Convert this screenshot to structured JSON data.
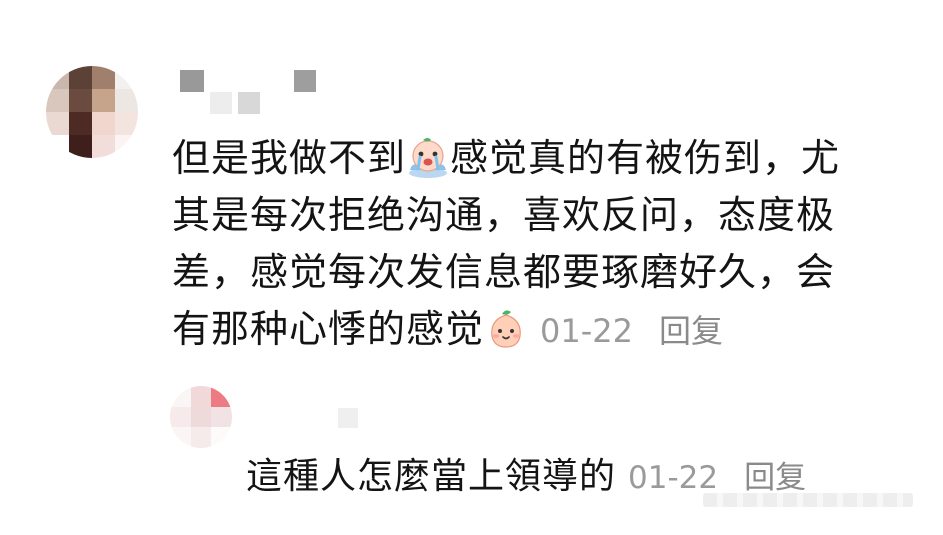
{
  "comment": {
    "text_lines": [
      "但是我做不到",
      "感觉真的有被伤到，尤",
      "其是每次拒绝沟通，喜欢反问，态度极",
      "差，感觉每次发信息都要琢磨好久，会",
      "有那种心悸的感觉"
    ],
    "date": "01-22",
    "reply_label": "回复",
    "emojis": [
      "crying-emoji",
      "peach-emoji"
    ]
  },
  "reply": {
    "text": "這種人怎麼當上領導的",
    "date": "01-22",
    "reply_label": "回复"
  },
  "colors": {
    "text": "#141414",
    "meta": "#9a9a9a"
  }
}
